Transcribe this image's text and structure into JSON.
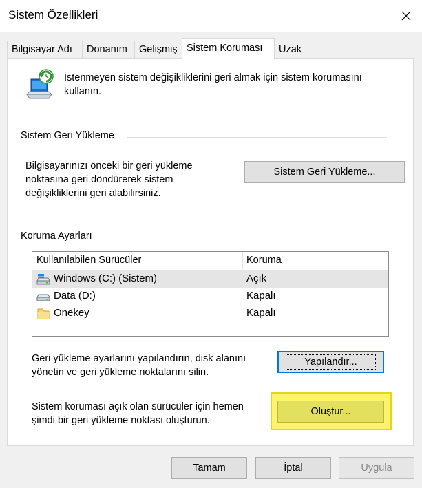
{
  "window": {
    "title": "Sistem Özellikleri"
  },
  "tabs": [
    {
      "label": "Bilgisayar Adı"
    },
    {
      "label": "Donanım"
    },
    {
      "label": "Gelişmiş"
    },
    {
      "label": "Sistem Koruması"
    },
    {
      "label": "Uzak"
    }
  ],
  "intro": {
    "text": "İstenmeyen sistem değişikliklerini geri almak için sistem korumasını kullanın."
  },
  "restore": {
    "group_title": "Sistem Geri Yükleme",
    "description": "Bilgisayarınızı önceki bir geri yükleme noktasına geri döndürerek sistem değişikliklerini geri alabilirsiniz.",
    "button_label": "Sistem Geri Yükleme..."
  },
  "protection": {
    "group_title": "Koruma Ayarları",
    "columns": {
      "drive": "Kullanılabilen Sürücüler",
      "protection": "Koruma"
    },
    "drives": [
      {
        "name": "Windows (C:) (Sistem)",
        "status": "Açık",
        "icon": "windows-drive-icon"
      },
      {
        "name": "Data (D:)",
        "status": "Kapalı",
        "icon": "drive-icon"
      },
      {
        "name": "Onekey",
        "status": "Kapalı",
        "icon": "folder-icon"
      }
    ],
    "configure_text": "Geri yükleme ayarlarını yapılandırın, disk alanını yönetin ve geri yükleme noktalarını silin.",
    "configure_label": "Yapılandır...",
    "create_text": "Sistem koruması açık olan sürücüler için hemen şimdi bir geri yükleme noktası oluşturun.",
    "create_label": "Oluştur..."
  },
  "footer": {
    "ok_label": "Tamam",
    "cancel_label": "İptal",
    "apply_label": "Uygula"
  },
  "colors": {
    "accent": "#0078d7",
    "highlight": "#fdf46b"
  }
}
